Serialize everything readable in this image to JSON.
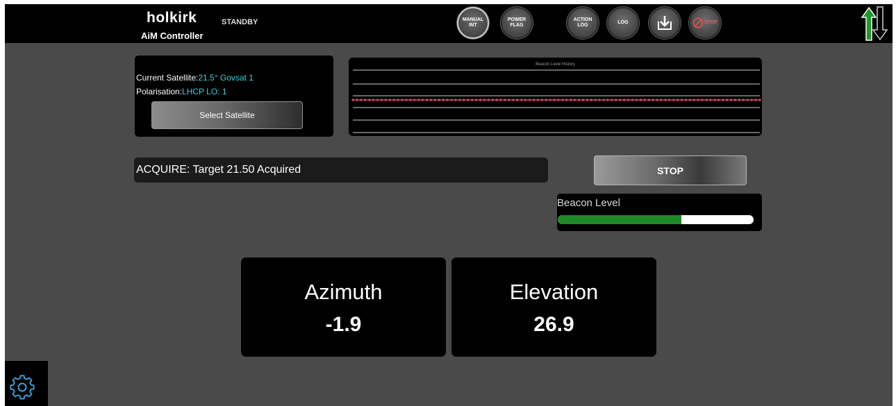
{
  "header": {
    "logo_brand": "holkirk",
    "logo_product": "AiM Controller",
    "mode": "STANDBY",
    "buttons": [
      {
        "label": "MANUAL INT"
      },
      {
        "label": "POWER FLAG"
      },
      {
        "label": "ACTION LOG"
      },
      {
        "label": "LOG"
      },
      {
        "icon": "download-icon"
      },
      {
        "label": "STOP",
        "icon": "prohibit-icon"
      }
    ]
  },
  "satellite": {
    "current_label": "Current Satellite:",
    "current_value": "21.5° Govsat 1",
    "polarisation_label": "Polarisation:",
    "polarisation_value": "LHCP LO: 1",
    "select_button": "Select Satellite"
  },
  "chart_data": {
    "type": "line",
    "title": "Beacon Level History",
    "series": [
      {
        "values": [
          0.5,
          0.5,
          0.5,
          0.5,
          0.5,
          0.5,
          0.5,
          0.5,
          0.5,
          0.5,
          0.5,
          0.5,
          0.5,
          0.5,
          0.5,
          0.5,
          0.5,
          0.5,
          0.5,
          0.5,
          0.5,
          0.5,
          0.5,
          0.5,
          0.5,
          0.5,
          0.5,
          0.5,
          0.5,
          0.5,
          0.5,
          0.5,
          0.5,
          0.5,
          0.5,
          0.5,
          0.5,
          0.5,
          0.5,
          0.5,
          0.5,
          0.5,
          0.5,
          0.5,
          0.5,
          0.5,
          0.5,
          0.5,
          0.5,
          0.5,
          0.5,
          0.5,
          0.5,
          0.5,
          0.5,
          0.5,
          0.5,
          0.5,
          0.5,
          0.5,
          0.5,
          0.5,
          0.5,
          0.5,
          0.5,
          0.5,
          0.5,
          0.5,
          0.5,
          0.5,
          0.5,
          0.5,
          0.5,
          0.5,
          0.5,
          0.5,
          0.5,
          0.5,
          0.5,
          0.5,
          0.5,
          0.5,
          0.5,
          0.5,
          0.5,
          0.5,
          0.5,
          0.5,
          0.5,
          0.5,
          0.5,
          0.5,
          0.5,
          0.5,
          0.5,
          0.5,
          0.5,
          0.5,
          0.5,
          0.5
        ]
      }
    ],
    "ylim": [
      0,
      1
    ],
    "grid": true,
    "line_color": "#e0506a"
  },
  "status": {
    "message": "ACQUIRE: Target 21.50 Acquired",
    "stop_button": "STOP"
  },
  "beacon": {
    "label": "Beacon Level",
    "level_fraction": 0.63,
    "fill_color": "#1f8a2a"
  },
  "position": {
    "azimuth_label": "Azimuth",
    "azimuth_value": "-1.9",
    "elevation_label": "Elevation",
    "elevation_value": "26.9"
  },
  "colors": {
    "accent_text": "#3fd0d8",
    "background": "#4a4a4a",
    "arrow_green": "#1f9a2a"
  }
}
